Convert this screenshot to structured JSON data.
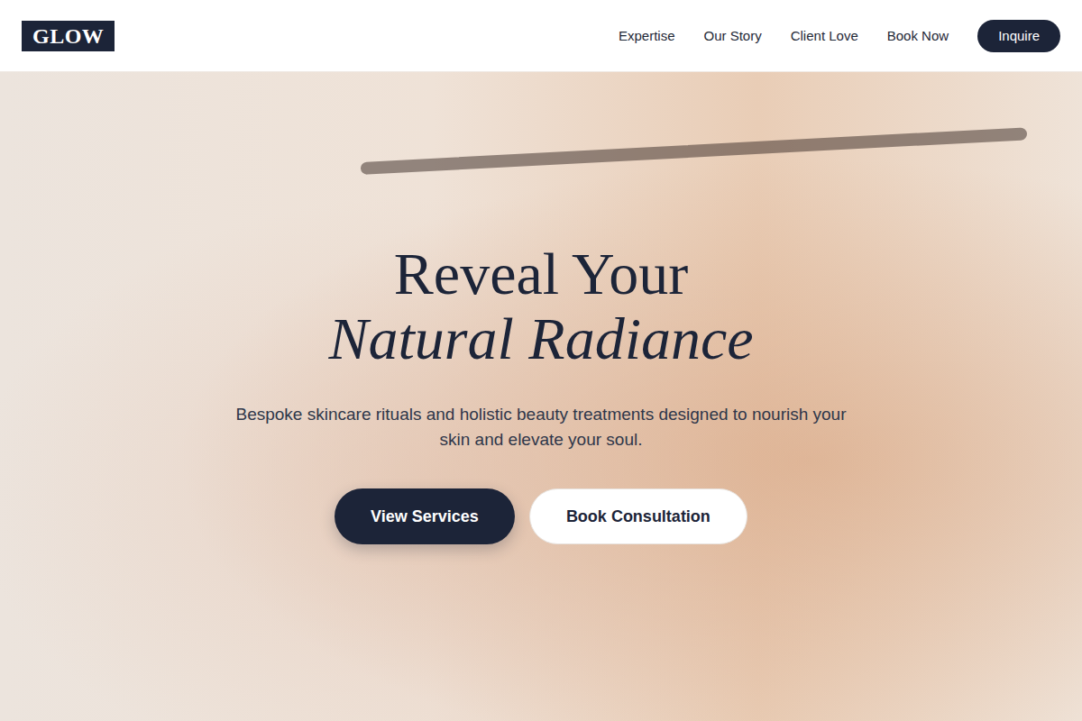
{
  "brand": {
    "logo": "GLOW"
  },
  "nav": {
    "links": [
      {
        "label": "Expertise"
      },
      {
        "label": "Our Story"
      },
      {
        "label": "Client Love"
      },
      {
        "label": "Book Now"
      }
    ],
    "cta": "Inquire"
  },
  "hero": {
    "title": "Reveal Your",
    "title_emphasis": "Natural Radiance",
    "subtitle": "Bespoke skincare rituals and holistic beauty treatments designed to nourish your skin and elevate your soul.",
    "buttons": [
      {
        "label": "View Services",
        "kind": "primary"
      },
      {
        "label": "Book Consultation",
        "kind": "secondary"
      }
    ]
  }
}
